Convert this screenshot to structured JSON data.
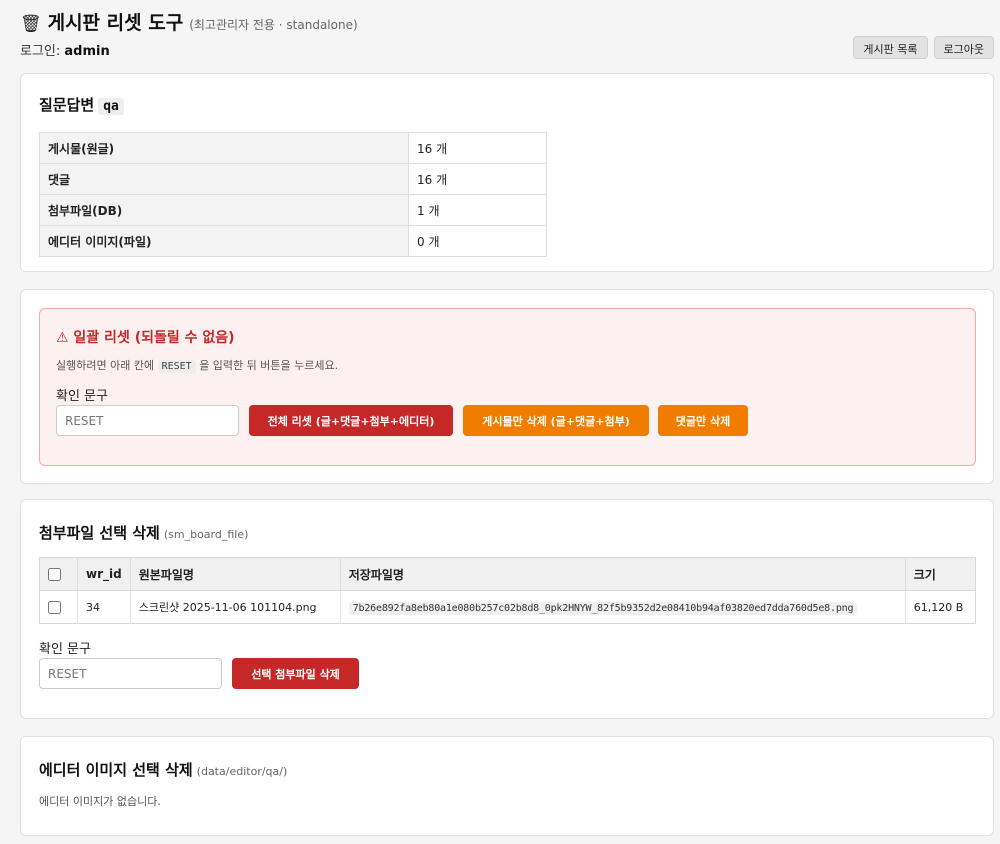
{
  "header": {
    "icon": "🗑",
    "title": "게시판 리셋 도구",
    "subtitle": "(최고관리자 전용 · standalone)",
    "login_label": "로그인:",
    "login_user": "admin",
    "board_list_button": "게시판 목록",
    "logout_button": "로그아웃"
  },
  "board": {
    "name": "질문답변",
    "code": "qa",
    "stats": [
      {
        "label": "게시물(원글)",
        "value": "16 개"
      },
      {
        "label": "댓글",
        "value": "16 개"
      },
      {
        "label": "첨부파일(DB)",
        "value": "1 개"
      },
      {
        "label": "에디터 이미지(파일)",
        "value": "0 개"
      }
    ]
  },
  "reset": {
    "title": "⚠ 일괄 리셋 (되돌릴 수 없음)",
    "desc_before": "실행하려면 아래 칸에",
    "desc_code": "RESET",
    "desc_after": "을 입력한 뒤 버튼을 누르세요.",
    "confirm_label": "확인 문구",
    "confirm_placeholder": "RESET",
    "btn_all": "전체 리셋 (글+댓글+첨부+에디터)",
    "btn_posts": "게시물만 삭제 (글+댓글+첨부)",
    "btn_comments": "댓글만 삭제"
  },
  "files": {
    "title": "첨부파일 선택 삭제",
    "subtitle": "(sm_board_file)",
    "columns": {
      "wr_id": "wr_id",
      "orig": "원본파일명",
      "saved": "저장파일명",
      "size": "크기"
    },
    "rows": [
      {
        "wr_id": "34",
        "orig": "스크린샷 2025-11-06 101104.png",
        "saved": "7b26e892fa8eb80a1e080b257c02b8d8_0pk2HNYW_82f5b9352d2e08410b94af03820ed7dda760d5e8.png",
        "size": "61,120 B"
      }
    ],
    "confirm_label": "확인 문구",
    "confirm_placeholder": "RESET",
    "delete_button": "선택 첨부파일 삭제"
  },
  "editor": {
    "title": "에디터 이미지 선택 삭제",
    "subtitle": "(data/editor/qa/)",
    "empty": "에디터 이미지가 없습니다."
  }
}
